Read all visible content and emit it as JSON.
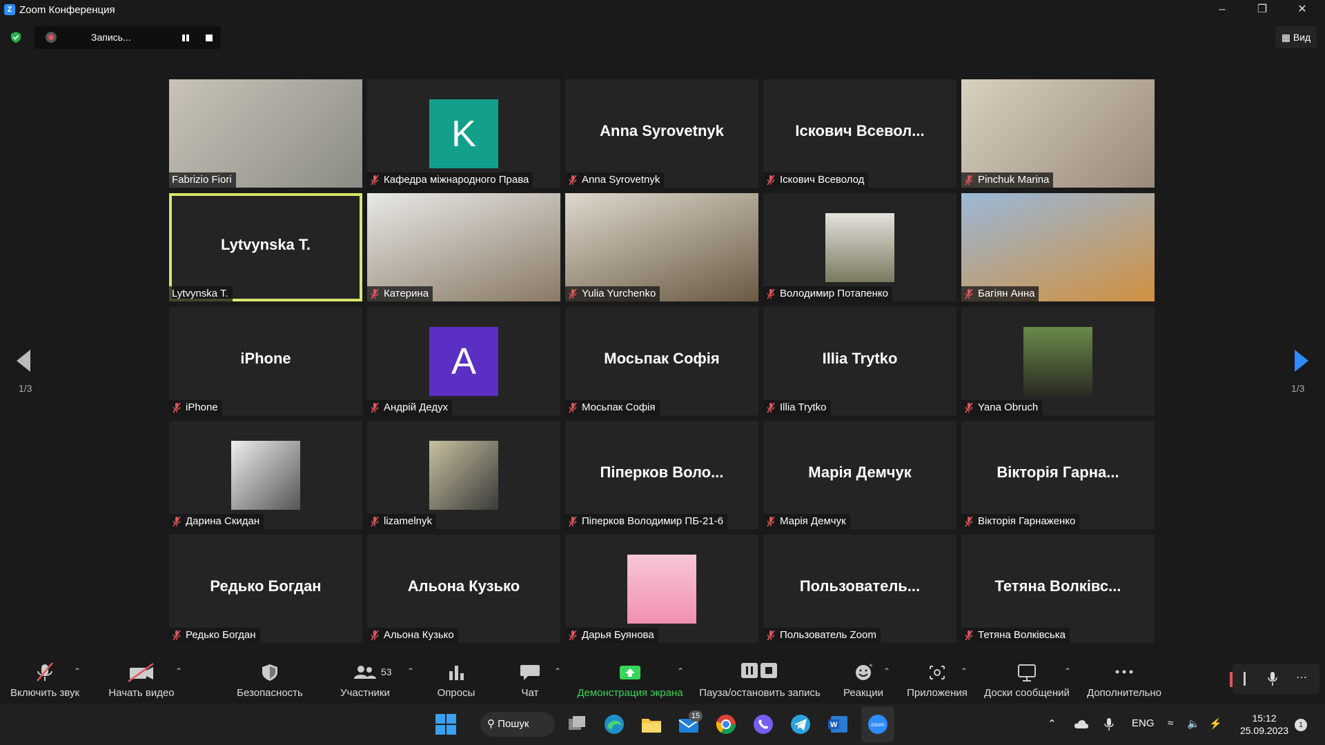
{
  "window": {
    "title": "Zoom Конференция"
  },
  "recording": {
    "label": "Запись..."
  },
  "view_button": {
    "label": "Вид"
  },
  "pagination": {
    "left": "1/3",
    "right": "1/3"
  },
  "participants": [
    {
      "big": "",
      "name": "Fabrizio Fiori",
      "kind": "video",
      "muted": false
    },
    {
      "big": "K",
      "name": "Кафедра міжнародного Права",
      "kind": "avatar",
      "avatar_color": "#12a08a",
      "muted": true
    },
    {
      "big": "Anna Syrovetnyk",
      "name": "Anna Syrovetnyk",
      "kind": "text",
      "muted": true
    },
    {
      "big": "Іскович  Всевол...",
      "name": "Іскович Всеволод",
      "kind": "text",
      "muted": true
    },
    {
      "big": "",
      "name": "Pinchuk Marina",
      "kind": "video",
      "muted": true
    },
    {
      "big": "Lytvynska T.",
      "name": "Lytvynska T.",
      "kind": "text",
      "muted": false,
      "active": true
    },
    {
      "big": "",
      "name": "Катерина",
      "kind": "video",
      "muted": true
    },
    {
      "big": "",
      "name": "Yulia Yurchenko",
      "kind": "video",
      "muted": true
    },
    {
      "big": "",
      "name": "Володимир Потапенко",
      "kind": "photo",
      "muted": true
    },
    {
      "big": "",
      "name": "Багіян Анна",
      "kind": "video",
      "muted": true
    },
    {
      "big": "iPhone",
      "name": "iPhone",
      "kind": "text",
      "muted": true
    },
    {
      "big": "A",
      "name": "Андрій Дедух",
      "kind": "avatar",
      "avatar_color": "#5b2fc4",
      "muted": true
    },
    {
      "big": "Мосьпак Софія",
      "name": "Мосьпак Софія",
      "kind": "text",
      "muted": true
    },
    {
      "big": "Illia Trytko",
      "name": "Illia Trytko",
      "kind": "text",
      "muted": true
    },
    {
      "big": "",
      "name": "Yana Obruch",
      "kind": "photo",
      "muted": true
    },
    {
      "big": "",
      "name": "Дарина Скидан",
      "kind": "photo",
      "muted": true
    },
    {
      "big": "",
      "name": "lizamelnyk",
      "kind": "photo",
      "muted": true
    },
    {
      "big": "Піперков  Воло...",
      "name": "Піперков Володимир ПБ-21-6",
      "kind": "text",
      "muted": true
    },
    {
      "big": "Марія Демчук",
      "name": "Марія Демчук",
      "kind": "text",
      "muted": true
    },
    {
      "big": "Вікторія  Гарна...",
      "name": "Вікторія Гарнаженко",
      "kind": "text",
      "muted": true
    },
    {
      "big": "Редько Богдан",
      "name": "Редько Богдан",
      "kind": "text",
      "muted": true
    },
    {
      "big": "Альона Кузько",
      "name": "Альона Кузько",
      "kind": "text",
      "muted": true
    },
    {
      "big": "",
      "name": "Дарья Буянова",
      "kind": "photo",
      "muted": true
    },
    {
      "big": "Пользователь...",
      "name": "Пользователь Zoom",
      "kind": "text",
      "muted": true
    },
    {
      "big": "Тетяна  Волківс...",
      "name": "Тетяна Волківська",
      "kind": "text",
      "muted": true
    }
  ],
  "toolbar": {
    "unmute": "Включить звук",
    "start_video": "Начать видео",
    "security": "Безопасность",
    "participants": "Участники",
    "participants_count": "53",
    "polls": "Опросы",
    "chat": "Чат",
    "share": "Демонстрация экрана",
    "pause_record": "Пауза/остановить запись",
    "reactions": "Реакции",
    "apps": "Приложения",
    "whiteboards": "Доски сообщений",
    "more": "Дополнительно"
  },
  "taskbar": {
    "search": "Пошук",
    "mail_badge": "15",
    "lang": "ENG",
    "time": "15:12",
    "date": "25.09.2023",
    "notif": "1"
  },
  "colors": {
    "accent": "#2D8CFF",
    "share_green": "#37d55a",
    "active_border": "#d8e66a",
    "muted_red": "#e0555a"
  }
}
